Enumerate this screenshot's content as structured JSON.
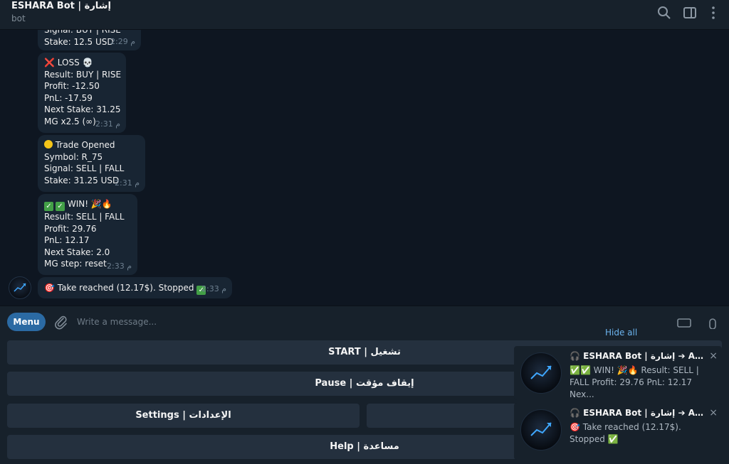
{
  "header": {
    "title": "ESHARA Bot | إشارة",
    "subtitle": "bot"
  },
  "messages": [
    {
      "lines": [
        "Signal: BUY | RISE",
        "Stake: 12.5 USD"
      ],
      "time": "2:29 م"
    },
    {
      "icon": "❌",
      "lines": [
        "LOSS 💀",
        "Result: BUY | RISE",
        "Profit: -12.50",
        "PnL: -17.59",
        "Next Stake: 31.25",
        "MG x2.5 (∞)"
      ],
      "time": "2:31 م"
    },
    {
      "lines": [
        "Trade Opened",
        "Symbol: R_75",
        "Signal: SELL | FALL",
        "Stake: 31.25 USD"
      ],
      "time": "2:31 م"
    },
    {
      "lines": [
        "WIN! 🎉🔥",
        "Result: SELL | FALL",
        "Profit: 29.76",
        "PnL: 12.17",
        "Next Stake: 2.0",
        "MG step: reset"
      ],
      "time": "2:33 م"
    },
    {
      "lines": [
        "🎯 Take reached (12.17$). Stopped"
      ],
      "time": "2:33 م"
    }
  ],
  "composer": {
    "menu_label": "Menu",
    "placeholder": "Write a message..."
  },
  "keyboard": {
    "start": "START | تشغيل",
    "pause": "Pause | إيقاف مؤقت",
    "settings": "Settings | الإعدادات",
    "help": "Help | مساعدة"
  },
  "notifications": {
    "hide_all": "Hide all",
    "items": [
      {
        "title": "🎧 ESHARA Bot | إشارة ➔ Aboal...",
        "body": "✅✅ WIN! 🎉🔥 Result: SELL | FALL Profit: 29.76 PnL: 12.17 Nex..."
      },
      {
        "title": "🎧 ESHARA Bot | إشارة ➔ Aboal...",
        "body": "🎯 Take reached (12.17$). Stopped ✅"
      }
    ],
    "close": "×"
  },
  "colors": {
    "background": "#0e1621",
    "panel": "#17212b",
    "bubble": "#182533",
    "accent": "#2b6aa3",
    "link": "#6cb4ee"
  }
}
